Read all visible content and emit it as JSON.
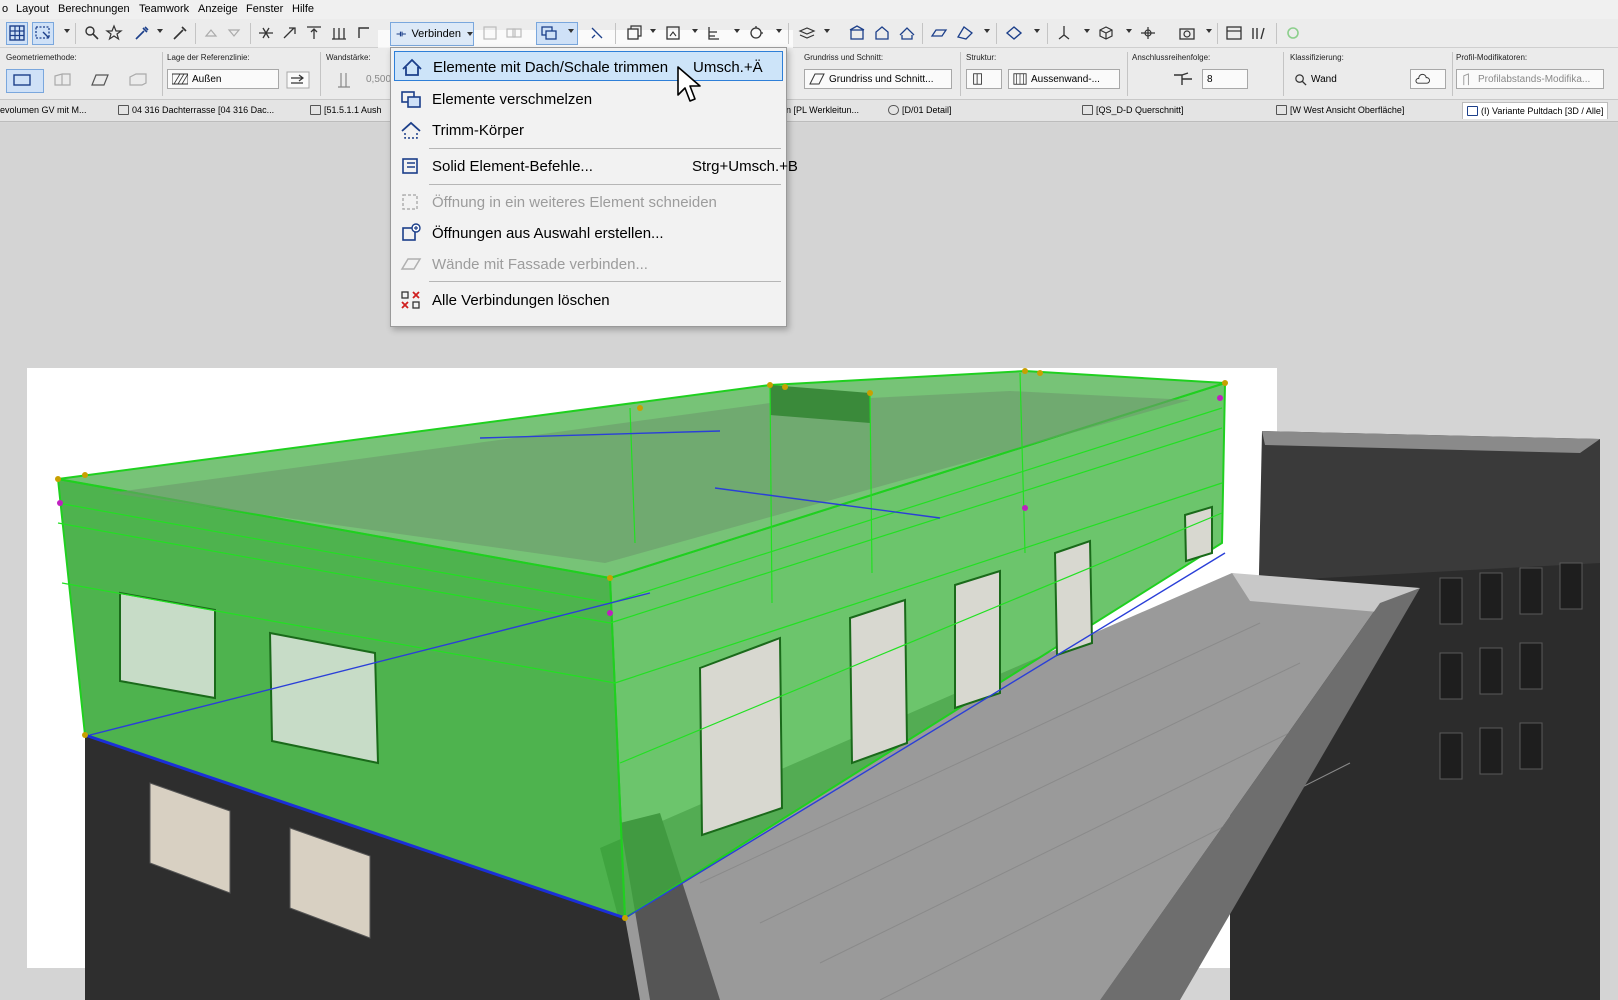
{
  "menubar": {
    "items": [
      "Layout",
      "Berechnungen",
      "Teamwork",
      "Anzeige",
      "Fenster",
      "Hilfe"
    ]
  },
  "toolbar": {
    "verbinden_label": "Verbinden"
  },
  "infobox": {
    "geometriemethode_label": "Geometriemethode:",
    "referenzlinie_label": "Lage der Referenzlinie:",
    "referenzlinie_value": "Außen",
    "wandstaerke_label": "Wandstärke:",
    "wandstaerke_value": "0,500",
    "grundriss_label": "Grundriss und Schnitt:",
    "grundriss_value": "Grundriss und Schnitt...",
    "struktur_label": "Struktur:",
    "struktur_value": "Aussenwand-...",
    "anschluss_label": "Anschlussreihenfolge:",
    "anschluss_value": "8",
    "klassifizierung_label": "Klassifizierung:",
    "klassifizierung_value": "Wand",
    "profil_label": "Profil-Modifikatoren:",
    "profil_value": "Profilabstands-Modifika..."
  },
  "tabs": [
    "evolumen GV mit M...",
    "04 316 Dachterrasse [04 316 Dac...",
    "[51.5.1.1 Aush",
    "n [PL Werkleitun...",
    "[D/01 Detail]",
    "[QS_D-D Querschnitt]",
    "[W West Ansicht Oberfläche]",
    "(I) Variante Pultdach [3D / Alle]"
  ],
  "dropdown": {
    "items": [
      {
        "label": "Elemente mit Dach/Schale trimmen",
        "shortcut": "Umsch.+Ä",
        "icon": "trim-roof-icon",
        "state": "highlighted"
      },
      {
        "label": "Elemente verschmelzen",
        "shortcut": "",
        "icon": "merge-elements-icon",
        "state": "enabled"
      },
      {
        "label": "Trimm-Körper",
        "shortcut": "",
        "icon": "trim-body-icon",
        "state": "enabled"
      },
      {
        "label": "Solid Element-Befehle...",
        "shortcut": "Strg+Umsch.+B",
        "icon": "solid-element-icon",
        "state": "enabled"
      },
      {
        "label": "Öffnung in ein weiteres Element schneiden",
        "shortcut": "",
        "icon": "cut-opening-icon",
        "state": "disabled"
      },
      {
        "label": "Öffnungen aus Auswahl erstellen...",
        "shortcut": "",
        "icon": "create-openings-icon",
        "state": "enabled"
      },
      {
        "label": "Wände mit Fassade verbinden...",
        "shortcut": "",
        "icon": "connect-facade-icon",
        "state": "disabled"
      },
      {
        "label": "Alle Verbindungen löschen",
        "shortcut": "",
        "icon": "delete-connections-icon",
        "state": "enabled"
      }
    ]
  },
  "colors": {
    "selection_green": "#2fbf2f",
    "menu_highlight": "#cde4f9",
    "reference_line_blue": "#1a2fd8"
  }
}
